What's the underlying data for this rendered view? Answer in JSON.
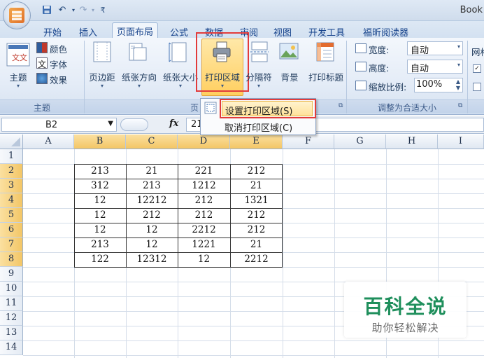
{
  "window": {
    "title": "Book"
  },
  "tabs": [
    "开始",
    "插入",
    "页面布局",
    "公式",
    "数据",
    "审阅",
    "视图",
    "开发工具",
    "福昕阅读器"
  ],
  "active_tab": "页面布局",
  "ribbon": {
    "theme": {
      "label": "主题",
      "colors": "颜色",
      "fonts": "字体",
      "effects": "效果",
      "group": "主题"
    },
    "page_setup": {
      "margins": "页边距",
      "orientation": "纸张方向",
      "size": "纸张大小",
      "print_area": "打印区域",
      "breaks": "分隔符",
      "background": "背景",
      "print_titles": "打印标题",
      "group": "页"
    },
    "scale": {
      "width_label": "宽度:",
      "width_value": "自动",
      "height_label": "高度:",
      "height_value": "自动",
      "scale_label": "缩放比例:",
      "scale_value": "100%",
      "group": "调整为合适大小"
    },
    "sheet_options_partial": "网格"
  },
  "dropdown": {
    "set_print_area": "设置打印区域(S)",
    "clear_print_area": "取消打印区域(C)"
  },
  "formula_bar": {
    "name_box": "B2",
    "fx": "fx",
    "value": "21"
  },
  "columns": [
    "A",
    "B",
    "C",
    "D",
    "E",
    "F",
    "G",
    "H",
    "I"
  ],
  "rows": [
    "1",
    "2",
    "3",
    "4",
    "5",
    "6",
    "7",
    "8",
    "9",
    "10",
    "11",
    "12",
    "13",
    "14"
  ],
  "table": [
    [
      "213",
      "21",
      "221",
      "212"
    ],
    [
      "312",
      "213",
      "1212",
      "21"
    ],
    [
      "12",
      "12212",
      "212",
      "1321"
    ],
    [
      "12",
      "212",
      "212",
      "212"
    ],
    [
      "12",
      "12",
      "2212",
      "212"
    ],
    [
      "213",
      "12",
      "1221",
      "21"
    ],
    [
      "122",
      "12312",
      "12",
      "2212"
    ]
  ],
  "watermark": {
    "title": "百科全说",
    "subtitle": "助你轻松解决"
  },
  "colors": {
    "highlight": "#e23b3b",
    "selected_header": "#f3c666",
    "watermark": "#1f8f5c"
  }
}
